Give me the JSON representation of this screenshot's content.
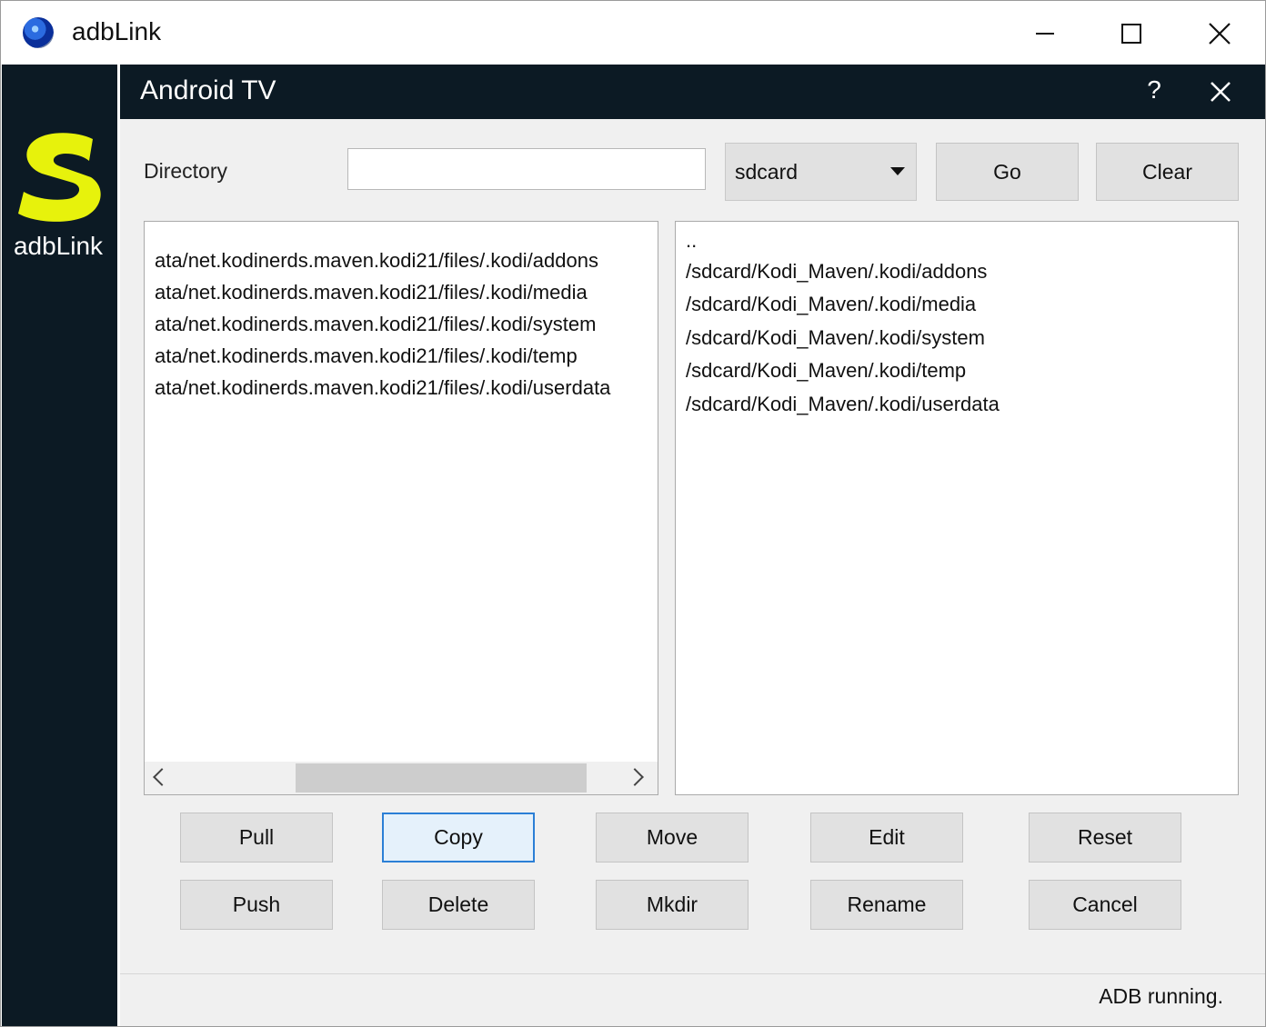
{
  "app": {
    "title": "adbLink",
    "sidebar_logo_text": "adbLink"
  },
  "dialog": {
    "title": "Android TV",
    "help_label": "?"
  },
  "directory": {
    "label": "Directory",
    "input_value": "",
    "location_selected": "sdcard",
    "go_label": "Go",
    "clear_label": "Clear"
  },
  "left_list": {
    "items": [
      "ata/net.kodinerds.maven.kodi21/files/.kodi/addons",
      "ata/net.kodinerds.maven.kodi21/files/.kodi/media",
      "ata/net.kodinerds.maven.kodi21/files/.kodi/system",
      "ata/net.kodinerds.maven.kodi21/files/.kodi/temp",
      "ata/net.kodinerds.maven.kodi21/files/.kodi/userdata"
    ]
  },
  "right_list": {
    "items": [
      "..",
      "/sdcard/Kodi_Maven/.kodi/addons",
      "/sdcard/Kodi_Maven/.kodi/media",
      "/sdcard/Kodi_Maven/.kodi/system",
      "/sdcard/Kodi_Maven/.kodi/temp",
      "/sdcard/Kodi_Maven/.kodi/userdata"
    ]
  },
  "actions": {
    "pull": "Pull",
    "copy": "Copy",
    "move": "Move",
    "edit": "Edit",
    "reset": "Reset",
    "push": "Push",
    "delete": "Delete",
    "mkdir": "Mkdir",
    "rename": "Rename",
    "cancel": "Cancel"
  },
  "status": {
    "text": "ADB running."
  },
  "colors": {
    "dark_panel": "#0c1a24",
    "logo_yellow": "#e7f20c",
    "focus_blue": "#2b7fd6",
    "dialog_bg": "#f0f0f0"
  }
}
